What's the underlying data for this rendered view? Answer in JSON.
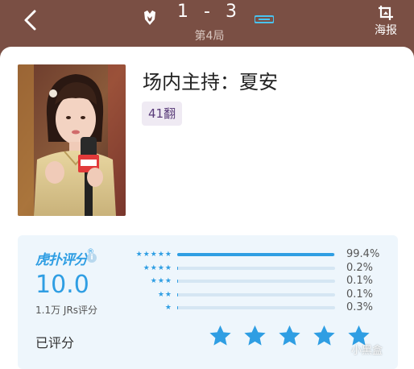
{
  "header": {
    "score": "1 - 3",
    "round": "第4局",
    "poster_label": "海报"
  },
  "host": {
    "title": "场内主持：夏安",
    "tag": "41翻"
  },
  "rating": {
    "brand": "虎扑评分",
    "brand_mark": "®",
    "score": "10.0",
    "count": "1.1万 JRs评分",
    "rated_label": "已评分",
    "distribution": [
      {
        "stars": "★★★★★",
        "percent_text": "99.4%",
        "percent": 99.4
      },
      {
        "stars": "★★★★",
        "percent_text": "0.2%",
        "percent": 0.2
      },
      {
        "stars": "★★★",
        "percent_text": "0.1%",
        "percent": 0.1
      },
      {
        "stars": "★★",
        "percent_text": "0.1%",
        "percent": 0.1
      },
      {
        "stars": "★",
        "percent_text": "0.3%",
        "percent": 0.3
      }
    ],
    "user_rating": 5
  },
  "colors": {
    "header_bg": "#7a4f44",
    "accent": "#2f9ee3",
    "card_bg": "#eef6fc"
  },
  "icons": [
    "back-arrow-icon",
    "crop-icon",
    "info-icon",
    "star-icon"
  ]
}
